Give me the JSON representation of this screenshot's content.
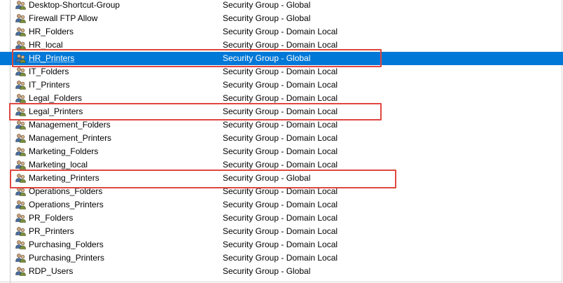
{
  "groups": [
    {
      "name": "Desktop-Shortcut-Group",
      "type": "Security Group - Global",
      "selected": false
    },
    {
      "name": "Firewall FTP Allow",
      "type": "Security Group - Global",
      "selected": false
    },
    {
      "name": "HR_Folders",
      "type": "Security Group - Domain Local",
      "selected": false
    },
    {
      "name": "HR_local",
      "type": "Security Group - Domain Local",
      "selected": false
    },
    {
      "name": "HR_Printers",
      "type": "Security Group - Global",
      "selected": true
    },
    {
      "name": "IT_Folders",
      "type": "Security Group - Domain Local",
      "selected": false
    },
    {
      "name": "IT_Printers",
      "type": "Security Group - Domain Local",
      "selected": false
    },
    {
      "name": "Legal_Folders",
      "type": "Security Group - Domain Local",
      "selected": false
    },
    {
      "name": "Legal_Printers",
      "type": "Security Group - Domain Local",
      "selected": false
    },
    {
      "name": "Management_Folders",
      "type": "Security Group - Domain Local",
      "selected": false
    },
    {
      "name": "Management_Printers",
      "type": "Security Group - Domain Local",
      "selected": false
    },
    {
      "name": "Marketing_Folders",
      "type": "Security Group - Domain Local",
      "selected": false
    },
    {
      "name": "Marketing_local",
      "type": "Security Group - Domain Local",
      "selected": false
    },
    {
      "name": "Marketing_Printers",
      "type": "Security Group - Global",
      "selected": false
    },
    {
      "name": "Operations_Folders",
      "type": "Security Group - Domain Local",
      "selected": false
    },
    {
      "name": "Operations_Printers",
      "type": "Security Group - Domain Local",
      "selected": false
    },
    {
      "name": "PR_Folders",
      "type": "Security Group - Domain Local",
      "selected": false
    },
    {
      "name": "PR_Printers",
      "type": "Security Group - Domain Local",
      "selected": false
    },
    {
      "name": "Purchasing_Folders",
      "type": "Security Group - Domain Local",
      "selected": false
    },
    {
      "name": "Purchasing_Printers",
      "type": "Security Group - Domain Local",
      "selected": false
    },
    {
      "name": "RDP_Users",
      "type": "Security Group - Global",
      "selected": false
    }
  ],
  "group_icon": "security-group-icon",
  "colors": {
    "selection": "#0078d7",
    "highlight_box": "#e0473f"
  }
}
